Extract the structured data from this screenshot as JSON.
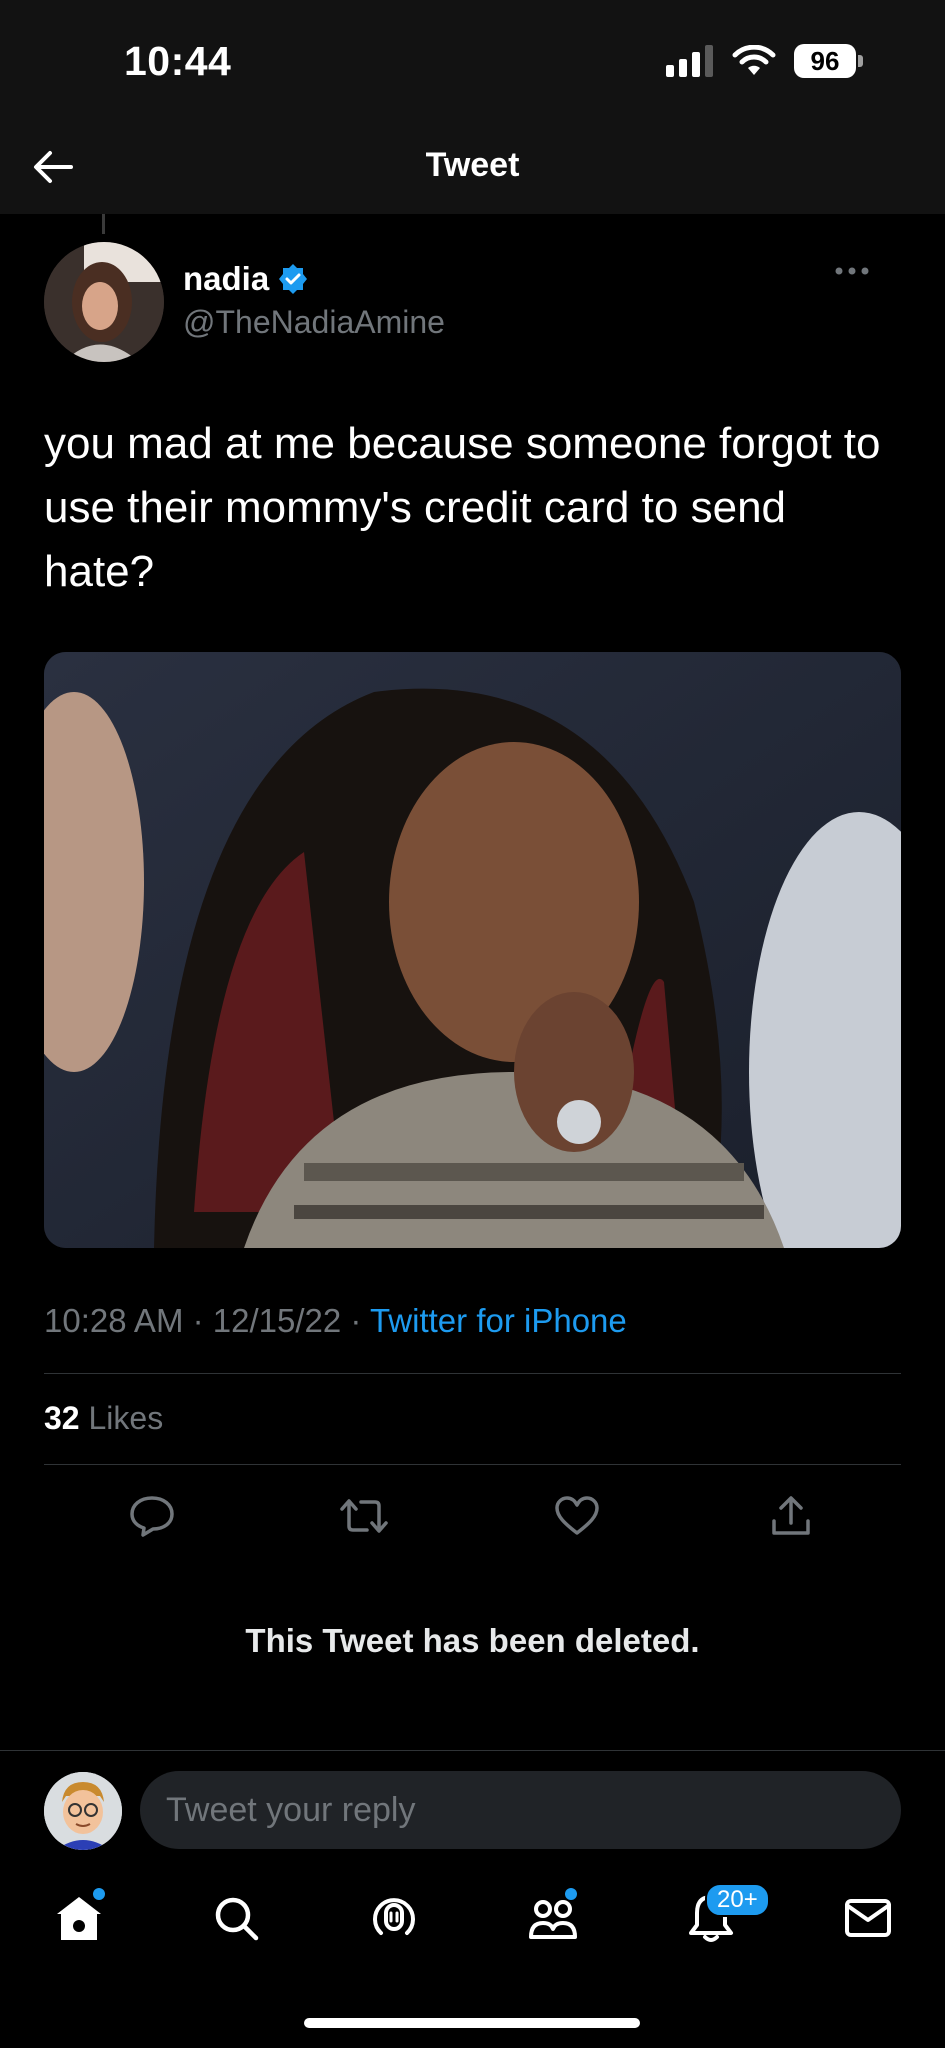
{
  "status_bar": {
    "time": "10:44",
    "battery": "96"
  },
  "nav": {
    "title": "Tweet"
  },
  "tweet": {
    "author_name": "nadia",
    "handle": "@TheNadiaAmine",
    "text": "you mad at me because someone forgot to use their mommy's credit card to send hate?",
    "time": "10:28 AM",
    "date": "12/15/22",
    "separator": " · ",
    "source": "Twitter for iPhone",
    "likes_count": "32",
    "likes_label": " Likes"
  },
  "deleted_notice": "This Tweet has been deleted.",
  "reply": {
    "placeholder": "Tweet your reply"
  },
  "tab_bar": {
    "notifications_badge": "20+"
  },
  "colors": {
    "accent": "#1d9bf0",
    "background": "#000000",
    "muted": "#71767b"
  },
  "icons": [
    "back-arrow-icon",
    "verified-badge-icon",
    "more-icon",
    "reply-icon",
    "retweet-icon",
    "like-icon",
    "share-icon",
    "home-icon",
    "search-icon",
    "spaces-icon",
    "communities-icon",
    "notifications-icon",
    "messages-icon"
  ]
}
